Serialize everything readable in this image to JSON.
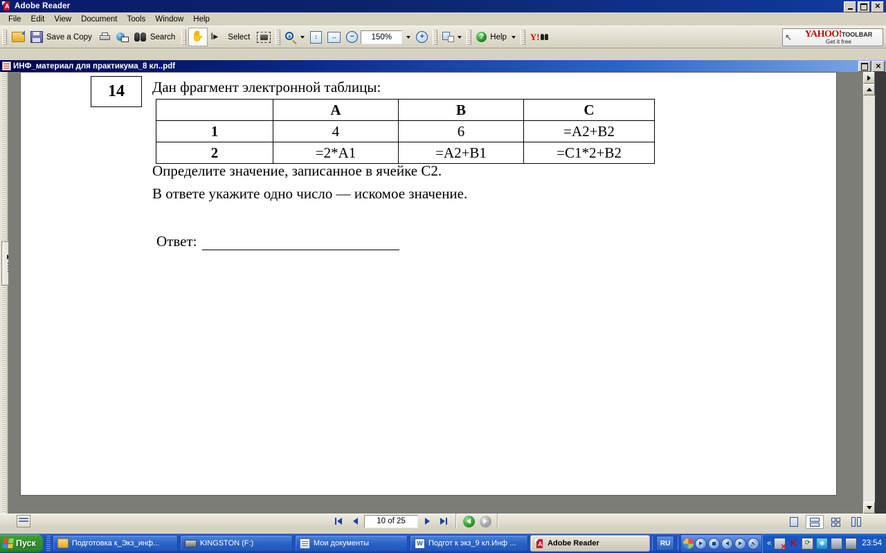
{
  "window": {
    "title": "Adobe Reader",
    "icon": "adobe-reader-icon",
    "controls": {
      "minimize": "_",
      "maximize": "□",
      "close": "✕"
    }
  },
  "menu": {
    "items": [
      {
        "label": "File"
      },
      {
        "label": "Edit"
      },
      {
        "label": "View"
      },
      {
        "label": "Document"
      },
      {
        "label": "Tools"
      },
      {
        "label": "Window"
      },
      {
        "label": "Help"
      }
    ]
  },
  "toolbar": {
    "open_label": "",
    "save_copy_label": "Save a Copy",
    "print_label": "",
    "email_label": "",
    "search_label": "Search",
    "hand_label": "",
    "select_label": "Select",
    "snapshot_label": "",
    "zoom_in_label": "",
    "fit_page_label": "",
    "fit_width_label": "",
    "zoom_out_label": "",
    "zoom_value": "150%",
    "zoom_plus_label": "+",
    "zoom_minus_label": "−",
    "pages_label": "",
    "help_label": "Help",
    "yahoo_label": ""
  },
  "yahoo_banner": {
    "brand": "YAHOO!",
    "toolbar_word": "TOOLBAR",
    "tagline": "Get it free"
  },
  "document_window": {
    "title": "ИНФ_материал для практикума_8 кл..pdf",
    "controls": {
      "minimize": "_",
      "restore": "□",
      "close": "✕"
    }
  },
  "navigation_pane": {
    "expand_arrows": "▶▶"
  },
  "document": {
    "question_number": "14",
    "prompt": "Дан фрагмент электронной таблицы:",
    "table": {
      "columns": [
        "",
        "A",
        "B",
        "C"
      ],
      "rows": [
        {
          "label": "1",
          "cells": [
            "4",
            "6",
            "=A2+B2"
          ]
        },
        {
          "label": "2",
          "cells": [
            "=2*A1",
            "=A2+B1",
            "=C1*2+B2"
          ]
        }
      ]
    },
    "instruction_line_1": "Определите значение, записанное в ячейке C2.",
    "instruction_line_2": "В ответе укажите одно число — искомое значение.",
    "answer_label": "Ответ:",
    "answer_value": ""
  },
  "status_bar": {
    "page_indicator": "10 of 25",
    "first_page_label": "",
    "previous_page_label": "",
    "next_page_label": "",
    "last_page_label": "",
    "previous_view_label": "",
    "next_view_label": "",
    "layout_single_label": "",
    "layout_continuous_label": "",
    "layout_facing_label": "",
    "layout_continuous_facing_label": ""
  },
  "taskbar": {
    "start_label": "Пуск",
    "items": [
      {
        "label": "Подготовка к_Экз_инф...",
        "icon": "folder-icon",
        "active": false
      },
      {
        "label": "KINGSTON (F:)",
        "icon": "usb-drive-icon",
        "active": false
      },
      {
        "label": "Мои документы",
        "icon": "documents-icon",
        "active": false
      },
      {
        "label": "Подгот к экз_9 кл.Инф ...",
        "icon": "word-document-icon",
        "active": false
      },
      {
        "label": "Adobe Reader",
        "icon": "adobe-reader-icon",
        "active": true
      }
    ],
    "language": "RU",
    "media_controls": [
      "play",
      "stop",
      "previous",
      "next",
      "mute"
    ],
    "tray_overflow": "«",
    "tray_icons": [
      "network-disconnected-icon",
      "kaspersky-icon",
      "sync-icon",
      "shield-icon",
      "usb-eject-icon",
      "display-icon"
    ],
    "clock": "23:54"
  },
  "colors": {
    "title_bar": "#0a246a",
    "chrome": "#d6d2c2",
    "taskbar": "#1b50c4",
    "start_button": "#2f8f26",
    "page": "#ffffff",
    "desktop_backdrop": "#7d7d78"
  }
}
